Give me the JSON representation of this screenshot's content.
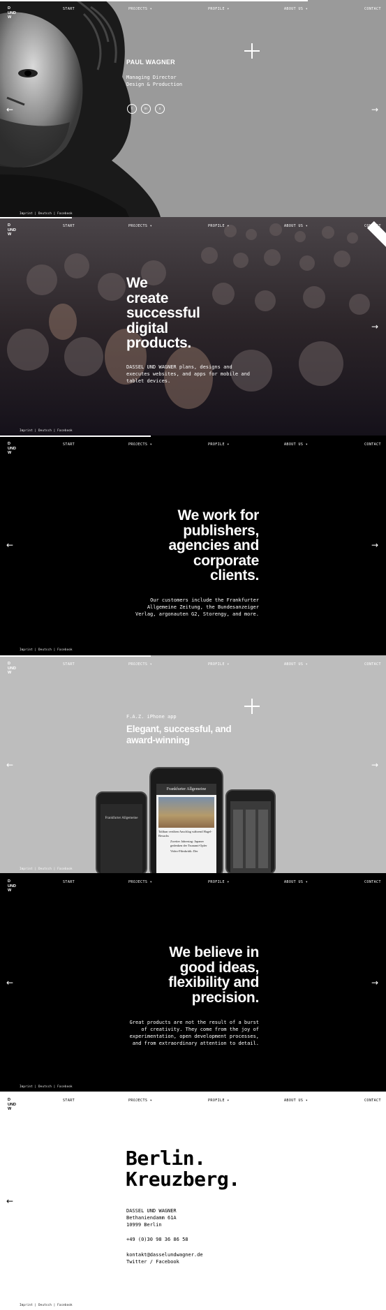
{
  "nav": {
    "logo": [
      "D",
      "UND",
      "W"
    ],
    "start": "START",
    "projects": "PROJECTS",
    "profile": "PROFILE",
    "about": "ABOUT US",
    "contact": "CONTACT",
    "caret": "▾"
  },
  "footer": "Imprint  |  Deutsch  |  Facebook",
  "arrows": {
    "left": "←",
    "right": "→"
  },
  "slide1": {
    "name": "PAUL WAGNER",
    "role_line1": "Managing Director",
    "role_line2": "Design & Production",
    "social": [
      "twitter-icon",
      "linkedin-icon",
      "xing-icon"
    ]
  },
  "slide2": {
    "heading": [
      "We",
      "create",
      "successful",
      "digital",
      "products."
    ],
    "body": [
      "DASSEL UND WAGNER plans, designs and",
      "executes websites, and apps for mobile and",
      "tablet devices."
    ]
  },
  "slide3": {
    "heading": [
      "We work for",
      "publishers,",
      "agencies and",
      "corporate",
      "clients."
    ],
    "body": [
      "Our customers include the Frankfurter",
      "Allgemeine Zeitung, the Bundesanzeiger",
      "Verlag, argonauten G2, Storengy, and more."
    ]
  },
  "slide4": {
    "eyebrow": "F.A.Z. iPhone app",
    "heading": [
      "Elegant, successful, and",
      "award-winning"
    ],
    "phone_masthead": "Frankfurter Allgemeine",
    "phone_headline1": "Taliban verüben Anschlag während Hagel-Besuchs",
    "phone_headline2": "Zweiter Jahrestag: Japaner gedenken der Tsunami-Opfer",
    "phone_headline3": "Video-Filmkritik: Der"
  },
  "slide5": {
    "heading": [
      "We believe in",
      "good ideas,",
      "flexibility and",
      "precision."
    ],
    "body": [
      "Great products are not the result of a burst",
      "of creativity. They come from the joy of",
      "experimentation, open development processes,",
      "and from extraordinary attention to detail."
    ]
  },
  "slide6": {
    "heading": [
      "Berlin.",
      "Kreuzberg."
    ],
    "address": [
      "DASSEL UND WAGNER",
      "Bethaniendamm 61A",
      "10999 Berlin"
    ],
    "phone": "+49 (0)30 98 36 86 58",
    "email": "kontakt@dasselundwagner.de",
    "social": "Twitter / Facebook"
  },
  "colors": {
    "gray": "#9a9a9a",
    "dark": "#1e1a1f",
    "black": "#000000",
    "light": "#bdbdbd",
    "white": "#ffffff"
  }
}
